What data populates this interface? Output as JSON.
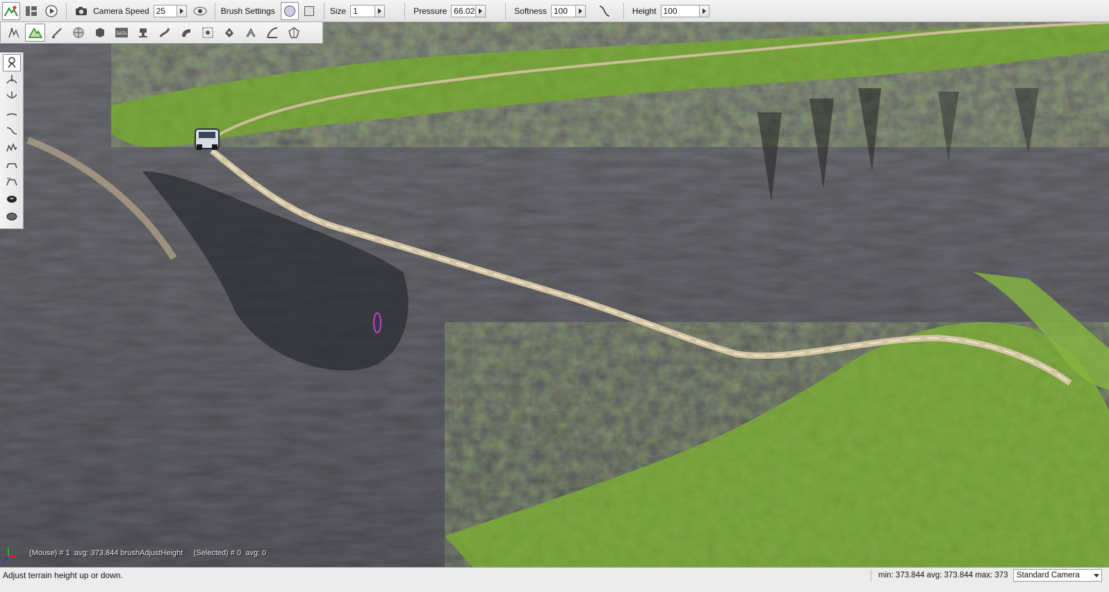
{
  "toolbar": {
    "camera_speed_label": "Camera Speed",
    "camera_speed_value": "25",
    "brush_settings_label": "Brush Settings",
    "size_label": "Size",
    "size_value": "1",
    "pressure_label": "Pressure",
    "pressure_value": "66.029",
    "softness_label": "Softness",
    "softness_value": "100",
    "height_label": "Height",
    "height_value": "100"
  },
  "toolstrip": {
    "icons": [
      "object-select-icon",
      "terrain-editor-icon",
      "terrain-painter-icon",
      "material-icon",
      "decal-icon",
      "datablock-icon",
      "road-icon",
      "river-icon",
      "mesh-road-icon",
      "forest-icon",
      "mission-area-icon",
      "particle-icon",
      "decal-road-icon",
      "convex-shape-icon"
    ],
    "data_badge": "DATA"
  },
  "brushbar": {
    "items": [
      "grab-terrain-icon",
      "raise-height-icon",
      "lower-height-icon",
      "smooth-icon",
      "slope-icon",
      "noise-icon",
      "flatten-icon",
      "set-height-icon",
      "set-empty-icon",
      "clear-empty-icon"
    ]
  },
  "viewport": {
    "overlay_text": "(Mouse) # 1  avg: 373.844 brushAdjustHeight     (Selected) # 0  avg: 0"
  },
  "statusbar": {
    "message": "Adjust terrain height up or down.",
    "stats": "min: 373.844  avg: 373.844  max: 373",
    "camera": "Standard Camera"
  },
  "colors": {
    "rock": "#6b6c72",
    "grass": "#7fae3c",
    "road": "#c9b896",
    "brush_cursor": "#c83cd8"
  }
}
